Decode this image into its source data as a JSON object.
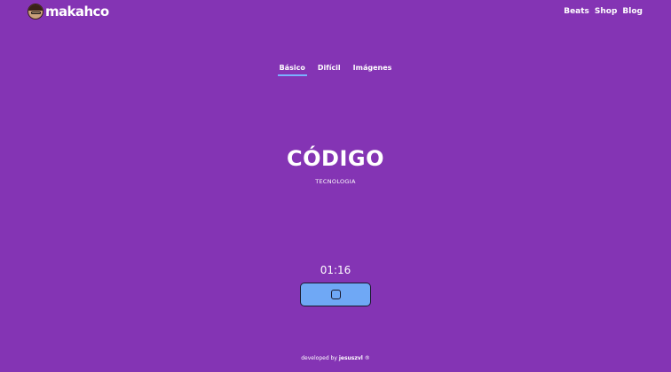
{
  "header": {
    "logo_text": "makahco",
    "nav": [
      "Beats",
      "Shop",
      "Blog"
    ]
  },
  "tabs": [
    {
      "label": "Básico",
      "active": true
    },
    {
      "label": "Difícil",
      "active": false
    },
    {
      "label": "Imágenes",
      "active": false
    }
  ],
  "card": {
    "word": "CÓDIGO",
    "category": "TECNOLOGIA"
  },
  "timer": "01:16",
  "action_button": {
    "icon": "stop-square-icon"
  },
  "footer": {
    "prefix": "developed by ",
    "author": "jesuszvl",
    "mark": "®"
  },
  "colors": {
    "background": "#8434b4",
    "accent": "#6fa8f5",
    "tab_underline": "#7ab0ff",
    "text": "#ffffff"
  }
}
